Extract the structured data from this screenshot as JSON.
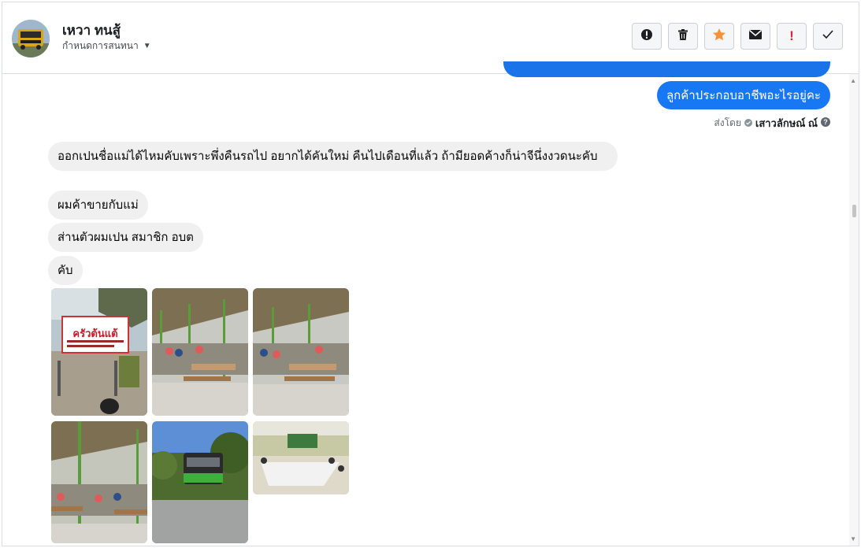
{
  "header": {
    "contact_name": "เหวา ทนสู้",
    "assign_label": "กำหนดการสนทนา",
    "actions": [
      "mark-spam",
      "delete",
      "star",
      "mark-unread",
      "follow-up",
      "done"
    ]
  },
  "conversation": {
    "outgoing_message": "ลูกค้าประกอบอาชีพอะไรอยู่คะ",
    "sent_by_prefix": "ส่งโดย",
    "sent_by_agent": "เสาวลักษณ์ ณ์",
    "incoming_messages": [
      "ออกเปนชื่อแม่ได้ไหมคับเพราะพึ่งคืนรถไป  อยากได้คันใหม่   คืนไปเดือนที่แล้ว   ถ้ามียอดค้างก็น่าจีนึ่งงวดนะคับ",
      "ผมค้าขายกับแม่",
      "ส่านตัวผมเปน สมาชิก   อบต",
      "คับ"
    ],
    "photo_sign_text": "ครัวต้นแต้"
  },
  "colors": {
    "accent": "#1877f2",
    "incoming_bubble": "#f0f0f0",
    "star": "#f7923a",
    "alert": "#e41e3f"
  }
}
